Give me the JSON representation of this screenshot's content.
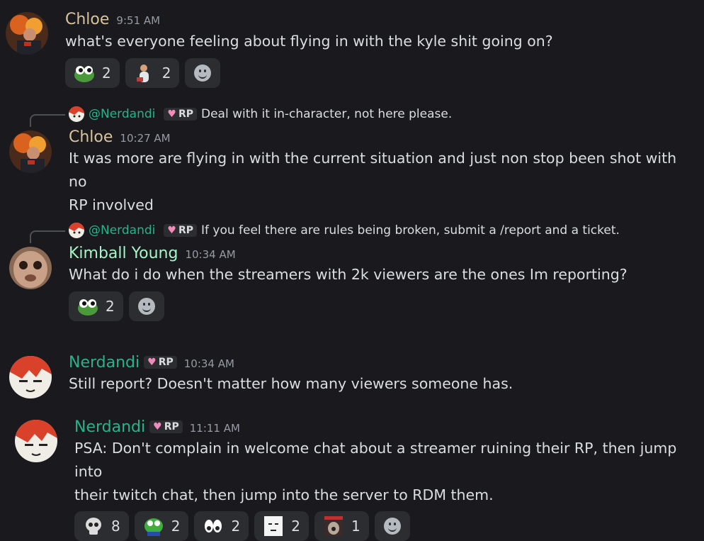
{
  "colors": {
    "background": "#1a1a1e",
    "chloe_name": "#d9c39b",
    "kimball_name": "#a6f5c7",
    "nerdandi_name": "#26b38c",
    "role_heart": "#f08bbb"
  },
  "messages": [
    {
      "author": "Chloe",
      "time": "9:51 AM",
      "lines": [
        "what's everyone feeling about flying in with the kyle shit going on?"
      ],
      "reactions": [
        {
          "icon": "frog-eyes-emoji-icon",
          "count": "2"
        },
        {
          "icon": "person-emoji-icon",
          "count": "2"
        }
      ]
    },
    {
      "reply": {
        "mention": "@Nerdandi",
        "role": "RP",
        "text": "Deal with it in-character, not here please."
      },
      "author": "Chloe",
      "time": "10:27 AM",
      "lines": [
        "It was more are flying in with the current situation and just non stop been shot with no",
        "RP involved"
      ]
    },
    {
      "reply": {
        "mention": "@Nerdandi",
        "role": "RP",
        "text": "If you feel there are rules being broken, submit a /report and a ticket."
      },
      "author": "Kimball Young",
      "time": "10:34 AM",
      "lines": [
        "What do i do when the streamers with 2k viewers are the ones Im reporting?"
      ],
      "reactions": [
        {
          "icon": "frog-eyes-emoji-icon",
          "count": "2"
        }
      ]
    },
    {
      "author": "Nerdandi",
      "role": "RP",
      "time": "10:34 AM",
      "lines": [
        "Still report? Doesn't matter how many viewers someone has."
      ]
    },
    {
      "author": "Nerdandi",
      "role": "RP",
      "time": "11:11 AM",
      "lines": [
        "PSA: Don't complain in welcome chat about a streamer ruining their RP, then jump into",
        "their twitch chat, then jump into the server to RDM them."
      ],
      "reactions": [
        {
          "icon": "skull-emoji-icon",
          "count": "8"
        },
        {
          "icon": "pepe-emoji-icon",
          "count": "2"
        },
        {
          "icon": "eyes-emoji-icon",
          "count": "2"
        },
        {
          "icon": "face-emoji-icon",
          "count": "2"
        },
        {
          "icon": "dog-emoji-icon",
          "count": "1"
        }
      ]
    }
  ]
}
